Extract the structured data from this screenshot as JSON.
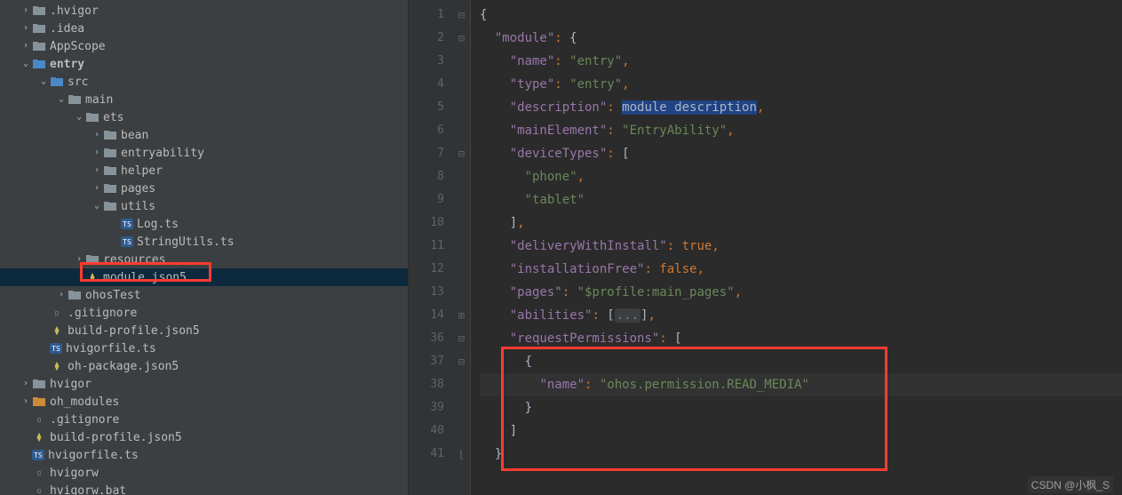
{
  "tree": [
    {
      "indent": 22,
      "chev": "right",
      "icon": "folder",
      "label": ".hvigor"
    },
    {
      "indent": 22,
      "chev": "right",
      "icon": "folder",
      "label": ".idea"
    },
    {
      "indent": 22,
      "chev": "right",
      "icon": "folder",
      "label": "AppScope"
    },
    {
      "indent": 22,
      "chev": "down",
      "icon": "folder-blue",
      "label": "entry",
      "bold": true
    },
    {
      "indent": 42,
      "chev": "down",
      "icon": "folder-blue",
      "label": "src"
    },
    {
      "indent": 62,
      "chev": "down",
      "icon": "folder",
      "label": "main"
    },
    {
      "indent": 82,
      "chev": "down",
      "icon": "folder",
      "label": "ets"
    },
    {
      "indent": 102,
      "chev": "right",
      "icon": "folder",
      "label": "bean"
    },
    {
      "indent": 102,
      "chev": "right",
      "icon": "folder",
      "label": "entryability"
    },
    {
      "indent": 102,
      "chev": "right",
      "icon": "folder",
      "label": "helper"
    },
    {
      "indent": 102,
      "chev": "right",
      "icon": "folder",
      "label": "pages"
    },
    {
      "indent": 102,
      "chev": "down",
      "icon": "folder",
      "label": "utils"
    },
    {
      "indent": 122,
      "chev": "",
      "icon": "ts",
      "label": "Log.ts"
    },
    {
      "indent": 122,
      "chev": "",
      "icon": "ts",
      "label": "StringUtils.ts"
    },
    {
      "indent": 82,
      "chev": "right",
      "icon": "folder",
      "label": "resources"
    },
    {
      "indent": 82,
      "chev": "",
      "icon": "json",
      "label": "module.json5",
      "selected": true
    },
    {
      "indent": 62,
      "chev": "right",
      "icon": "folder",
      "label": "ohosTest"
    },
    {
      "indent": 42,
      "chev": "",
      "icon": "file",
      "label": ".gitignore"
    },
    {
      "indent": 42,
      "chev": "",
      "icon": "json",
      "label": "build-profile.json5"
    },
    {
      "indent": 42,
      "chev": "",
      "icon": "ts",
      "label": "hvigorfile.ts"
    },
    {
      "indent": 42,
      "chev": "",
      "icon": "json",
      "label": "oh-package.json5"
    },
    {
      "indent": 22,
      "chev": "right",
      "icon": "folder",
      "label": "hvigor"
    },
    {
      "indent": 22,
      "chev": "right",
      "icon": "folder-orange",
      "label": "oh_modules"
    },
    {
      "indent": 22,
      "chev": "",
      "icon": "file",
      "label": ".gitignore"
    },
    {
      "indent": 22,
      "chev": "",
      "icon": "json",
      "label": "build-profile.json5"
    },
    {
      "indent": 22,
      "chev": "",
      "icon": "ts",
      "label": "hvigorfile.ts"
    },
    {
      "indent": 22,
      "chev": "",
      "icon": "file",
      "label": "hvigorw"
    },
    {
      "indent": 22,
      "chev": "",
      "icon": "file",
      "label": "hvigorw.bat"
    }
  ],
  "gutter": [
    "1",
    "2",
    "3",
    "4",
    "5",
    "6",
    "7",
    "8",
    "9",
    "10",
    "11",
    "12",
    "13",
    "14",
    "36",
    "37",
    "38",
    "39",
    "40",
    "41"
  ],
  "fold": [
    "⊟",
    "⊟",
    "",
    "",
    "",
    "",
    "⊟",
    "",
    "",
    "",
    "",
    "",
    "",
    "⊞",
    "⊟",
    "⊟",
    "",
    "",
    "",
    "⌊"
  ],
  "code_lines": [
    [
      [
        "brace",
        "{"
      ]
    ],
    [
      [
        "",
        "  "
      ],
      [
        "key",
        "\"module\""
      ],
      [
        "punc",
        ": "
      ],
      [
        "brace",
        "{"
      ]
    ],
    [
      [
        "",
        "    "
      ],
      [
        "key",
        "\"name\""
      ],
      [
        "punc",
        ": "
      ],
      [
        "str",
        "\"entry\""
      ],
      [
        "punc",
        ","
      ]
    ],
    [
      [
        "",
        "    "
      ],
      [
        "key",
        "\"type\""
      ],
      [
        "punc",
        ": "
      ],
      [
        "str",
        "\"entry\""
      ],
      [
        "punc",
        ","
      ]
    ],
    [
      [
        "",
        "    "
      ],
      [
        "key",
        "\"description\""
      ],
      [
        "punc",
        ": "
      ],
      [
        "sel",
        "module description"
      ],
      [
        "punc",
        ","
      ]
    ],
    [
      [
        "",
        "    "
      ],
      [
        "key",
        "\"mainElement\""
      ],
      [
        "punc",
        ": "
      ],
      [
        "str",
        "\"EntryAbility\""
      ],
      [
        "punc",
        ","
      ]
    ],
    [
      [
        "",
        "    "
      ],
      [
        "key",
        "\"deviceTypes\""
      ],
      [
        "punc",
        ": "
      ],
      [
        "brace",
        "["
      ]
    ],
    [
      [
        "",
        "      "
      ],
      [
        "str",
        "\"phone\""
      ],
      [
        "punc",
        ","
      ]
    ],
    [
      [
        "",
        "      "
      ],
      [
        "str",
        "\"tablet\""
      ]
    ],
    [
      [
        "",
        "    "
      ],
      [
        "brace",
        "]"
      ],
      [
        "punc",
        ","
      ]
    ],
    [
      [
        "",
        "    "
      ],
      [
        "key",
        "\"deliveryWithInstall\""
      ],
      [
        "punc",
        ": "
      ],
      [
        "kw",
        "true"
      ],
      [
        "punc",
        ","
      ]
    ],
    [
      [
        "",
        "    "
      ],
      [
        "key",
        "\"installationFree\""
      ],
      [
        "punc",
        ": "
      ],
      [
        "kw",
        "false"
      ],
      [
        "punc",
        ","
      ]
    ],
    [
      [
        "",
        "    "
      ],
      [
        "key",
        "\"pages\""
      ],
      [
        "punc",
        ": "
      ],
      [
        "str",
        "\"$profile:main_pages\""
      ],
      [
        "punc",
        ","
      ]
    ],
    [
      [
        "",
        "    "
      ],
      [
        "key",
        "\"abilities\""
      ],
      [
        "punc",
        ": "
      ],
      [
        "brace",
        "["
      ],
      [
        "fold",
        "..."
      ],
      [
        "brace",
        "]"
      ],
      [
        "punc",
        ","
      ]
    ],
    [
      [
        "",
        "    "
      ],
      [
        "key",
        "\"requestPermissions\""
      ],
      [
        "punc",
        ": "
      ],
      [
        "brace",
        "["
      ]
    ],
    [
      [
        "",
        "      "
      ],
      [
        "brace",
        "{"
      ]
    ],
    [
      [
        "",
        "        "
      ],
      [
        "key",
        "\"name\""
      ],
      [
        "punc",
        ": "
      ],
      [
        "str",
        "\"ohos.permission.READ_MEDIA\""
      ]
    ],
    [
      [
        "",
        "      "
      ],
      [
        "brace",
        "}"
      ]
    ],
    [
      [
        "",
        "    "
      ],
      [
        "brace",
        "]"
      ]
    ],
    [
      [
        "",
        "  "
      ],
      [
        "brace",
        "}"
      ]
    ]
  ],
  "current_line_index": 16,
  "watermark": "CSDN @小枫_S"
}
